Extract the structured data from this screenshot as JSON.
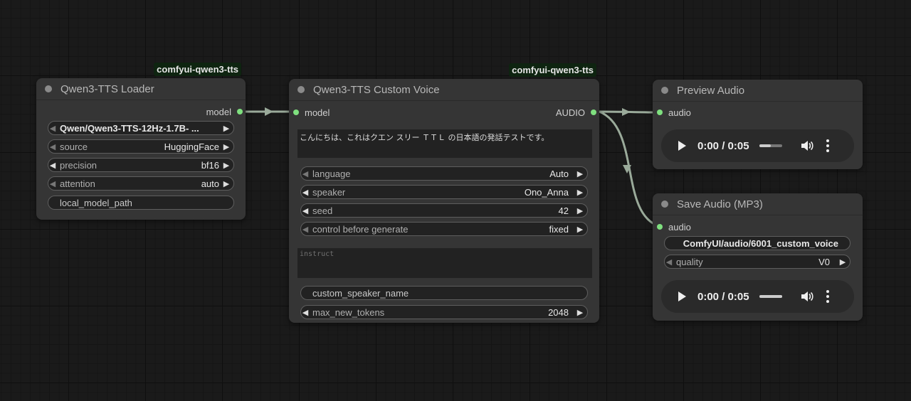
{
  "loader": {
    "badge": "comfyui-qwen3-tts",
    "title": "Qwen3-TTS Loader",
    "output_label": "model",
    "widgets": [
      {
        "label": "",
        "value": "Qwen/Qwen3-TTS-12Hz-1.7B- ..."
      },
      {
        "label": "source",
        "value": "HuggingFace"
      },
      {
        "label": "precision",
        "value": "bf16"
      },
      {
        "label": "attention",
        "value": "auto"
      }
    ],
    "local_model_path": "local_model_path"
  },
  "custom_voice": {
    "badge": "comfyui-qwen3-tts",
    "title": "Qwen3-TTS Custom Voice",
    "input_label": "model",
    "output_label": "AUDIO",
    "text": "こんにちは、これはクエン スリー ＴＴＬ の日本語の発話テストです。",
    "widgets": [
      {
        "label": "language",
        "value": "Auto"
      },
      {
        "label": "speaker",
        "value": "Ono_Anna"
      },
      {
        "label": "seed",
        "value": "42"
      },
      {
        "label": "control before generate",
        "value": "fixed"
      }
    ],
    "instruct_placeholder": "instruct",
    "custom_speaker_name": "custom_speaker_name",
    "max_new_tokens": {
      "label": "max_new_tokens",
      "value": "2048"
    }
  },
  "preview": {
    "title": "Preview Audio",
    "input_label": "audio",
    "player": {
      "time": "0:00 / 0:05",
      "progress": 0.5
    }
  },
  "save": {
    "title": "Save Audio (MP3)",
    "input_label": "audio",
    "filename": "ComfyUI/audio/6001_custom_voice",
    "quality": {
      "label": "quality",
      "value": "V0"
    },
    "player": {
      "time": "0:00 / 0:05",
      "progress": 1.0
    }
  },
  "colors": {
    "slot": "#7fe07f",
    "link": "#9aaa9a",
    "node_bg": "#353535",
    "canvas_bg": "#1a1a1a"
  }
}
